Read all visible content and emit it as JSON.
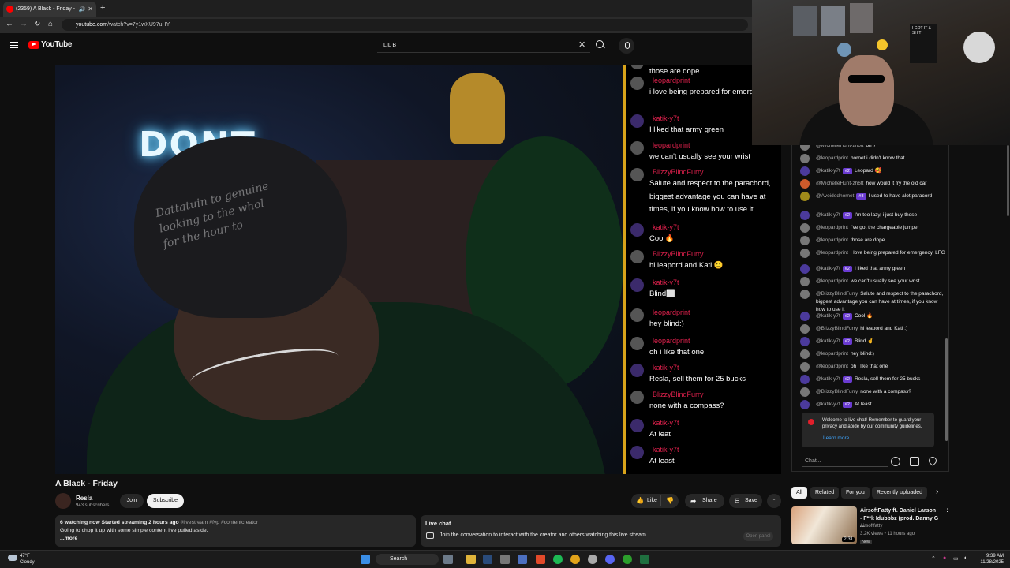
{
  "browser": {
    "tab_title": "(2359) A Black - Friday - Yo",
    "url_site": "youtube.com",
    "url_path": "/watch?v=7y1wXU97uHY"
  },
  "header": {
    "logo_text": "YouTube",
    "search_value": "LIL B"
  },
  "video": {
    "neon_text": "DONT",
    "beanie_text": "Dattatuin to genuine\nlooking to the whol\nfor the hour to"
  },
  "overlay_chat": [
    {
      "name": "",
      "text": "those are dope",
      "avatar": "grey"
    },
    {
      "name": "leopardprint",
      "text": "i love being prepared for emerg LFG",
      "avatar": "grey"
    },
    {
      "name": "katik-y7t",
      "text": "I liked that army green",
      "avatar": "purple"
    },
    {
      "name": "leopardprint",
      "text": "we can't usually see your wrist",
      "avatar": "grey"
    },
    {
      "name": "BlizzyBlindFurry",
      "text": "Salute and respect to the parachord, biggest advantage you can have at times, if you know how to use it",
      "avatar": "grey"
    },
    {
      "name": "katik-y7t",
      "text": "Cool🔥",
      "avatar": "purple"
    },
    {
      "name": "BlizzyBlindFurry",
      "text": "hi leapord and Kati 🙂",
      "avatar": "grey"
    },
    {
      "name": "katik-y7t",
      "text": "Blind⬜",
      "avatar": "purple"
    },
    {
      "name": "leopardprint",
      "text": "hey blind:)",
      "avatar": "grey"
    },
    {
      "name": "leopardprint",
      "text": "oh i like that one",
      "avatar": "grey"
    },
    {
      "name": "katik-y7t",
      "text": "Resla, sell them for 25 bucks",
      "avatar": "purple"
    },
    {
      "name": "BlizzyBlindFurry",
      "text": "none with a compass?",
      "avatar": "grey"
    },
    {
      "name": "katik-y7t",
      "text": "At leat",
      "avatar": "purple"
    },
    {
      "name": "katik-y7t",
      "text": "At least",
      "avatar": "purple"
    }
  ],
  "webcam": {
    "shirt_art": "I GOT IT & SHIT"
  },
  "live_chat": {
    "messages": [
      {
        "name": "@MichelleHunt-zh6tt",
        "badge": "",
        "text": "oh ?",
        "avatar": "grey"
      },
      {
        "name": "@leopardprint",
        "badge": "",
        "text": "hornet i didn't know that",
        "avatar": "grey"
      },
      {
        "name": "@katik-y7t",
        "badge": "#2",
        "text": "Leopard 🥰",
        "avatar": "purple"
      },
      {
        "name": "@MichelleHunt-zh6tt",
        "badge": "",
        "text": "how would it fry the old car",
        "avatar": "orange"
      },
      {
        "name": "@Avoidedhornet",
        "badge": "#3",
        "text": "I used to have alot paracord",
        "avatar": "yellow"
      },
      {
        "name": "@katik-y7t",
        "badge": "#2",
        "text": "I'm too lazy, i just buy those",
        "avatar": "purple"
      },
      {
        "name": "@leopardprint",
        "badge": "",
        "text": "i've got the chargeable jumper",
        "avatar": "grey"
      },
      {
        "name": "@leopardprint",
        "badge": "",
        "text": "those are dope",
        "avatar": "grey"
      },
      {
        "name": "@leopardprint",
        "badge": "",
        "text": "i love being prepared for emergency. LFG",
        "avatar": "grey"
      },
      {
        "name": "@katik-y7t",
        "badge": "#2",
        "text": "I liked that army green",
        "avatar": "purple"
      },
      {
        "name": "@leopardprint",
        "badge": "",
        "text": "we can't usually see your wrist",
        "avatar": "grey"
      },
      {
        "name": "@BlizzyBlindFurry",
        "badge": "",
        "text": "Salute and respect to the parachord, biggest advantage you can have at times, if you know how to use it",
        "avatar": "grey"
      },
      {
        "name": "@katik-y7t",
        "badge": "#2",
        "text": "Cool 🔥",
        "avatar": "purple"
      },
      {
        "name": "@BlizzyBlindFurry",
        "badge": "",
        "text": "hi leapord and Kati :)",
        "avatar": "grey"
      },
      {
        "name": "@katik-y7t",
        "badge": "#2",
        "text": "Blind ✌",
        "avatar": "purple"
      },
      {
        "name": "@leopardprint",
        "badge": "",
        "text": "hey blind:)",
        "avatar": "grey"
      },
      {
        "name": "@leopardprint",
        "badge": "",
        "text": "oh i like that one",
        "avatar": "grey"
      },
      {
        "name": "@katik-y7t",
        "badge": "#2",
        "text": "Resla, sell them for 25 bucks",
        "avatar": "purple"
      },
      {
        "name": "@BlizzyBlindFurry",
        "badge": "",
        "text": "none with a compass?",
        "avatar": "grey"
      },
      {
        "name": "@katik-y7t",
        "badge": "#2",
        "text": "At least",
        "avatar": "purple"
      }
    ],
    "welcome_text": "Welcome to live chat! Remember to guard your privacy and abide by our community guidelines.",
    "learn_more": "Learn more",
    "input_placeholder": "Chat..."
  },
  "below": {
    "title": "A Black - Friday",
    "channel": "Resla",
    "subscribers": "943 subscribers",
    "join": "Join",
    "subscribe": "Subscribe",
    "like": "Like",
    "share": "Share",
    "save": "Save",
    "desc_stats": "6 watching now  Started streaming 2 hours ago",
    "desc_tags": "#livestream #fyp #contentcreator",
    "desc_text": "Going to chop it up with some simple content I've pulled aside.",
    "desc_more": "...more",
    "livechat_title": "Live chat",
    "livechat_text": "Join the conversation to interact with the creator and others watching this live stream.",
    "open_panel": "Open panel"
  },
  "recs": {
    "chips": [
      "All",
      "Related",
      "For you",
      "Recently uploaded"
    ],
    "title": "AirsoftFatty  ft. Daniel Larson - F**k Idubbbz (prod. Danny G ...",
    "channel": "Airsoftfatty",
    "meta": "3.2K views • 11 hours ago",
    "badge": "New",
    "duration": "2:31"
  },
  "taskbar": {
    "temp": "47°F",
    "condition": "Cloudy",
    "search": "Search",
    "time": "9:39 AM",
    "date": "11/28/2025"
  }
}
